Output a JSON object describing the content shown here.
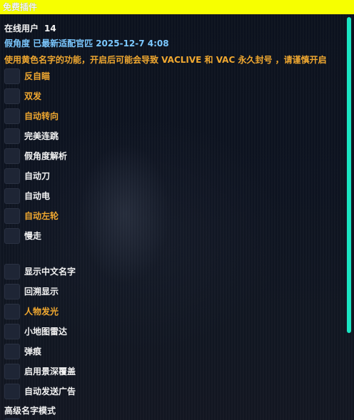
{
  "window": {
    "title": "免费插件"
  },
  "status": {
    "online_label": "在线用户",
    "online_count": "14",
    "version_text": "假角度 已最新适配官匹",
    "version_date": "2025-12-7 4:08",
    "warning": "使用黄色名字的功能，开启后可能会导致 VACLIVE 和 VAC 永久封号 ，请谨慎开启"
  },
  "features_group1": [
    {
      "label": "反自瞄",
      "risky": true
    },
    {
      "label": "双发",
      "risky": true
    },
    {
      "label": "自动转向",
      "risky": true
    },
    {
      "label": "完美连跳",
      "risky": false
    },
    {
      "label": "假角度解析",
      "risky": false
    },
    {
      "label": "自动刀",
      "risky": false
    },
    {
      "label": "自动电",
      "risky": false
    },
    {
      "label": "自动左轮",
      "risky": true
    },
    {
      "label": "慢走",
      "risky": false
    }
  ],
  "features_group2": [
    {
      "label": "显示中文名字",
      "risky": false
    },
    {
      "label": "回溯显示",
      "risky": false
    },
    {
      "label": "人物发光",
      "risky": true
    },
    {
      "label": "小地图雷达",
      "risky": false
    },
    {
      "label": "弹痕",
      "risky": false
    },
    {
      "label": "启用景深覆盖",
      "risky": false
    },
    {
      "label": "自动发送广告",
      "risky": false
    }
  ],
  "advanced": {
    "title": "高级名字模式"
  },
  "colors": {
    "titlebar": "#f7ff00",
    "risky_text": "#f0a830",
    "info_text": "#7bc8ff",
    "normal_text": "#f2f2f2",
    "scrollbar": "#19e5c3",
    "checkbox": "#1e2535"
  }
}
